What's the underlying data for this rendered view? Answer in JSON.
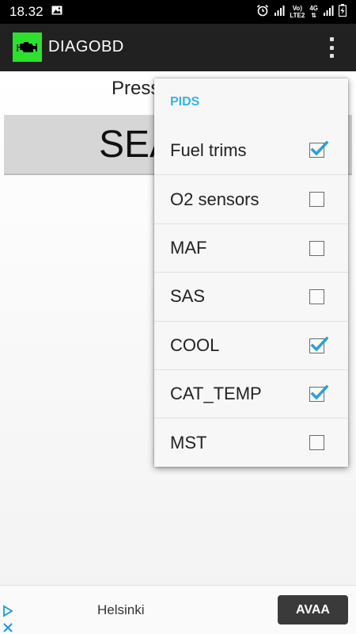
{
  "status_bar": {
    "time": "18.32",
    "network_top": "Vo)",
    "network_bottom": "LTE2",
    "network_type": "4G",
    "icons": [
      "image-icon",
      "alarm-icon",
      "signal-icon",
      "signal-icon",
      "battery-charging-icon"
    ]
  },
  "app_bar": {
    "title": "DIAGOBD",
    "icon": "engine-icon",
    "menu_icon": "overflow-menu-icon",
    "accent": "#2ee02e"
  },
  "main": {
    "instruction": "Press SEARCH",
    "button_label": "SEARCH"
  },
  "menu": {
    "header": "PIDS",
    "header_color": "#33b5e5",
    "items": [
      {
        "label": "Fuel trims",
        "checked": true
      },
      {
        "label": "O2 sensors",
        "checked": false
      },
      {
        "label": "MAF",
        "checked": false
      },
      {
        "label": "SAS",
        "checked": false
      },
      {
        "label": "COOL",
        "checked": true
      },
      {
        "label": "CAT_TEMP",
        "checked": true
      },
      {
        "label": "MST",
        "checked": false
      }
    ]
  },
  "ad": {
    "text": "Helsinki",
    "cta": "AVAA"
  },
  "colors": {
    "check_mark": "#2a9fd6"
  }
}
